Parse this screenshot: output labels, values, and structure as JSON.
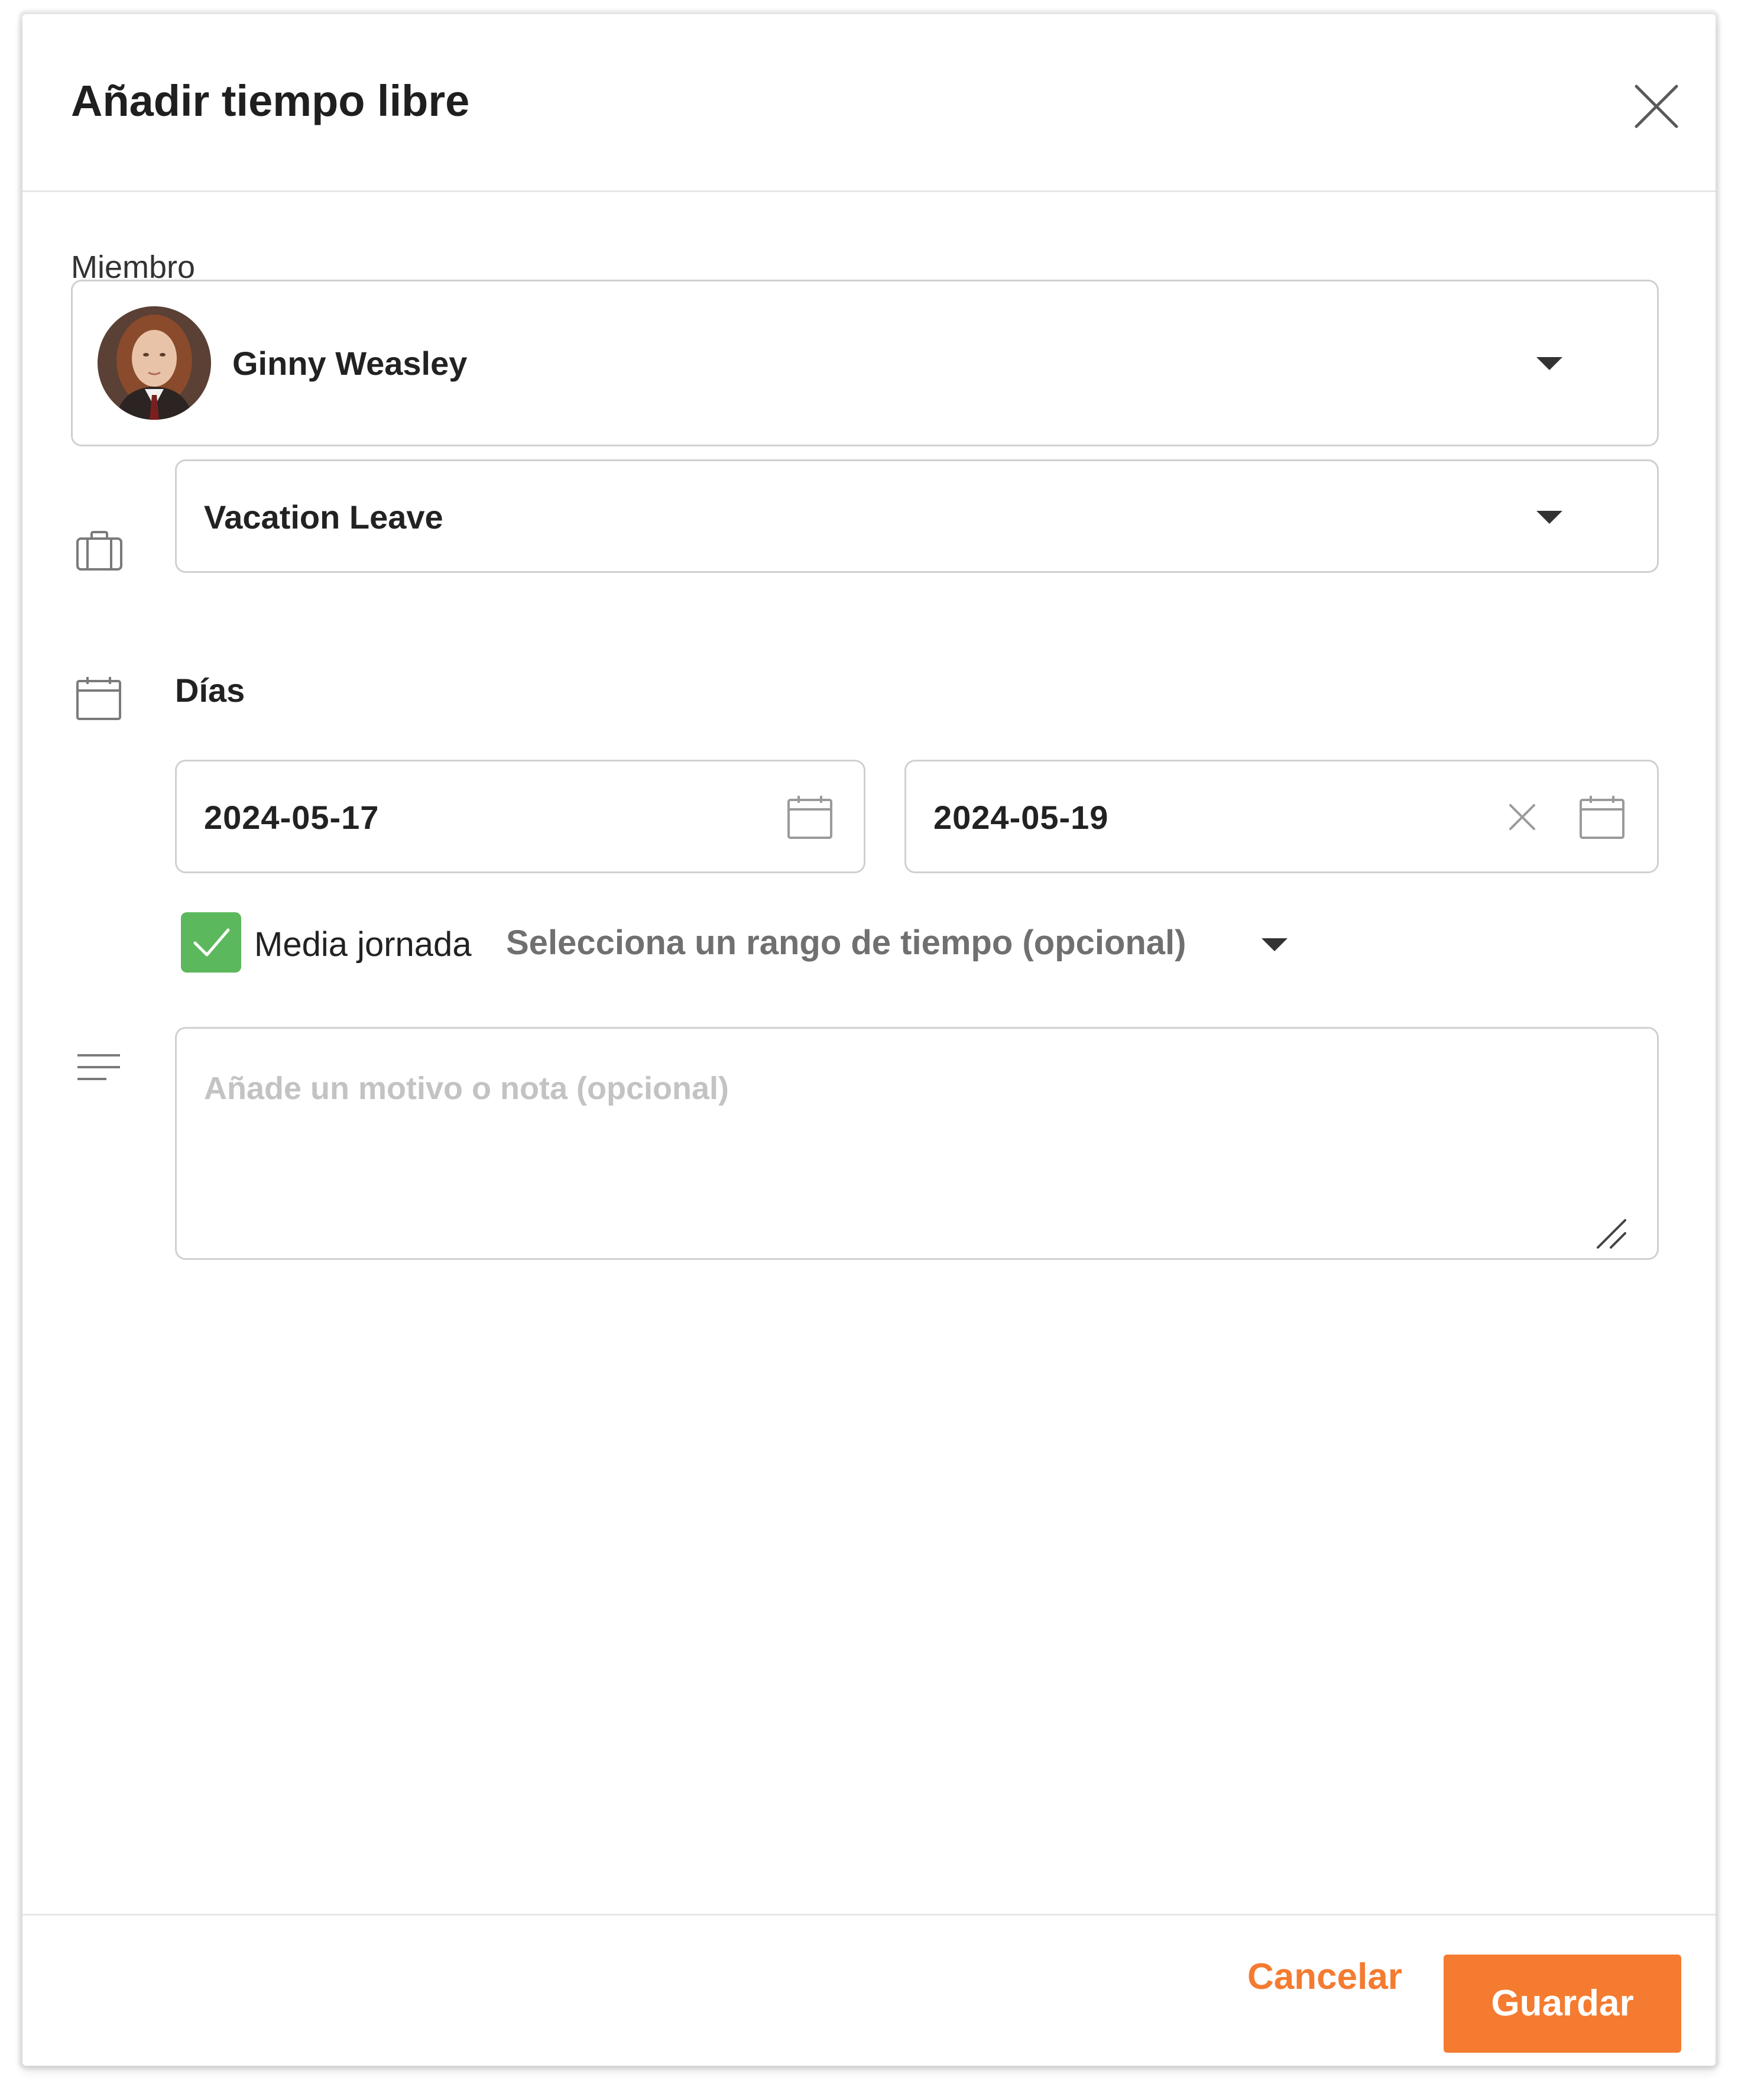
{
  "dialog": {
    "title": "Añadir tiempo libre"
  },
  "member": {
    "label": "Miembro",
    "name": "Ginny Weasley"
  },
  "leave_type": {
    "value": "Vacation Leave"
  },
  "days": {
    "label": "Días",
    "start_date": "2024-05-17",
    "end_date": "2024-05-19"
  },
  "half_day": {
    "label": "Media jornada",
    "checked": true,
    "time_range_placeholder": "Selecciona un rango de tiempo (opcional)"
  },
  "notes": {
    "placeholder": "Añade un motivo o nota (opcional)"
  },
  "footer": {
    "cancel_label": "Cancelar",
    "save_label": "Guardar"
  },
  "icons": {
    "close": "close-icon",
    "member_dropdown": "chevron-down-icon",
    "leave_type": "briefcase-icon",
    "days": "calendar-icon",
    "start_picker": "calendar-icon",
    "clear_end": "close-icon",
    "end_picker": "calendar-icon",
    "checkbox": "checkmark-icon",
    "notes": "text-lines-icon",
    "resize": "resize-handle-icon"
  },
  "colors": {
    "accent": "#f47b30",
    "checkbox": "#5cb85c",
    "border": "#d0d0d0",
    "placeholder": "#c3c3c3"
  }
}
